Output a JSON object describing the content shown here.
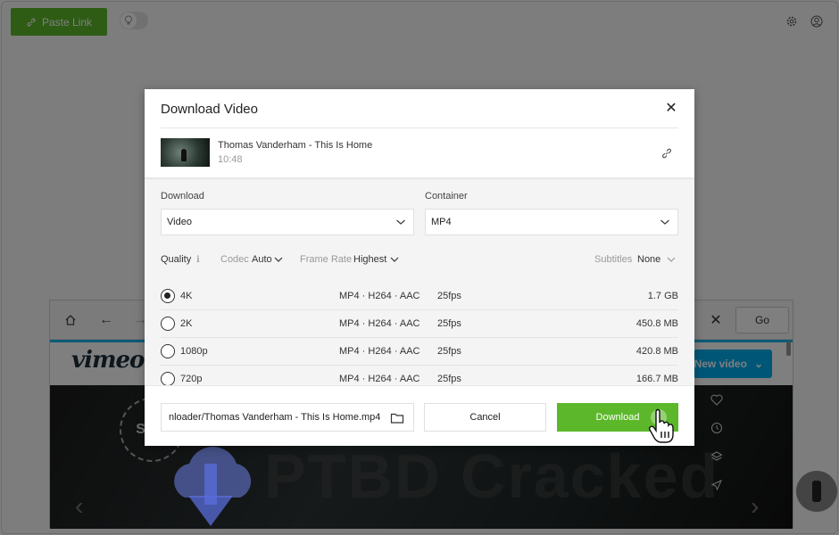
{
  "app": {
    "paste_link_label": "Paste Link",
    "brand_color": "#5cb82a"
  },
  "browser": {
    "go_label": "Go",
    "new_video_label": "New video",
    "site_logo": "vimeo",
    "accent_color": "#1ab7ea",
    "channel_logo_text": "ST P",
    "watermark_text": "PTBD Cracked"
  },
  "dialog": {
    "title": "Download Video",
    "video": {
      "title": "Thomas Vanderham - This Is Home",
      "duration": "10:48"
    },
    "download_label": "Download",
    "download_value": "Video",
    "container_label": "Container",
    "container_value": "MP4",
    "quality_label": "Quality",
    "codec_label": "Codec",
    "codec_value": "Auto",
    "frame_rate_label": "Frame Rate",
    "frame_rate_value": "Highest",
    "subtitles_label": "Subtitles",
    "subtitles_value": "None",
    "qualities": [
      {
        "name": "4K",
        "format": "MP4 · H264 · AAC",
        "fps": "25fps",
        "size": "1.7 GB",
        "selected": true
      },
      {
        "name": "2K",
        "format": "MP4 · H264 · AAC",
        "fps": "25fps",
        "size": "450.8 MB",
        "selected": false
      },
      {
        "name": "1080p",
        "format": "MP4 · H264 · AAC",
        "fps": "25fps",
        "size": "420.8 MB",
        "selected": false
      },
      {
        "name": "720p",
        "format": "MP4 · H264 · AAC",
        "fps": "25fps",
        "size": "166.7 MB",
        "selected": false
      }
    ],
    "save_path": "nloader/Thomas Vanderham - This Is Home.mp4",
    "cancel_label": "Cancel",
    "download_button_label": "Download"
  }
}
